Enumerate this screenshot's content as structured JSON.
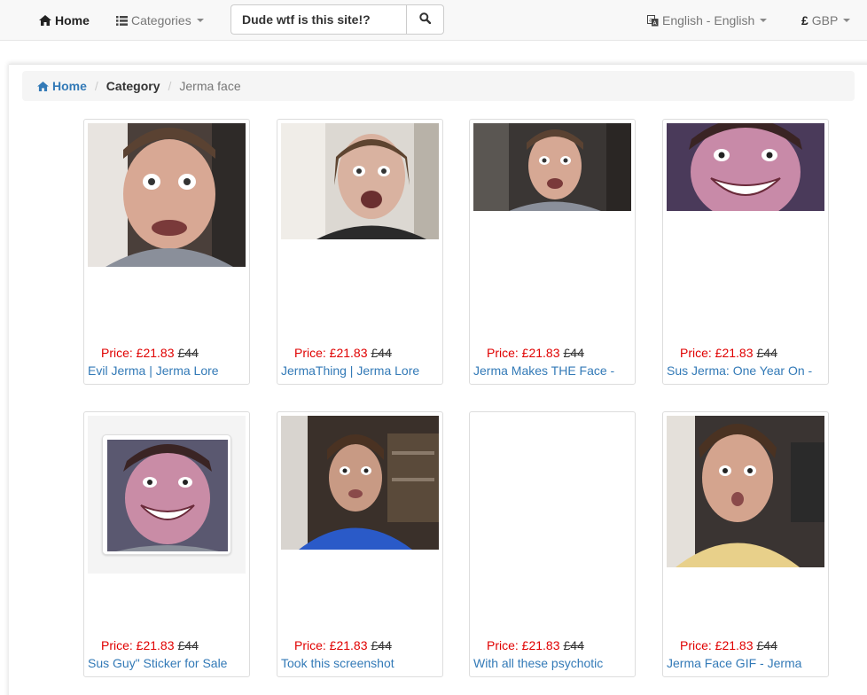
{
  "nav": {
    "home_label": "Home",
    "categories_label": "Categories",
    "search_value": "Dude wtf is this site!?",
    "language_label": "English - English",
    "currency_label": "GBP",
    "currency_symbol": "£"
  },
  "breadcrumb": {
    "home": "Home",
    "sep1": "/",
    "category": "Category",
    "sep2": "/",
    "current": "Jerma face"
  },
  "products": [
    {
      "price_label": "Price: £21.83",
      "old_price": "£44",
      "title": "Evil Jerma | Jerma Lore"
    },
    {
      "price_label": "Price: £21.83",
      "old_price": "£44",
      "title": "JermaThing | Jerma Lore"
    },
    {
      "price_label": "Price: £21.83",
      "old_price": "£44",
      "title": "Jerma Makes THE Face -"
    },
    {
      "price_label": "Price: £21.83",
      "old_price": "£44",
      "title": "Sus Jerma: One Year On -"
    },
    {
      "price_label": "Price: £21.83",
      "old_price": "£44",
      "title": "Sus Guy\" Sticker for Sale"
    },
    {
      "price_label": "Price: £21.83",
      "old_price": "£44",
      "title": "Took this screenshot"
    },
    {
      "price_label": "Price: £21.83",
      "old_price": "£44",
      "title": "With all these psychotic"
    },
    {
      "price_label": "Price: £21.83",
      "old_price": "£44",
      "title": "Jerma Face GIF - Jerma"
    }
  ],
  "colors": {
    "link": "#337ab7",
    "price": "#e00000",
    "navbar_bg": "#f8f8f8",
    "breadcrumb_bg": "#f5f5f5"
  }
}
